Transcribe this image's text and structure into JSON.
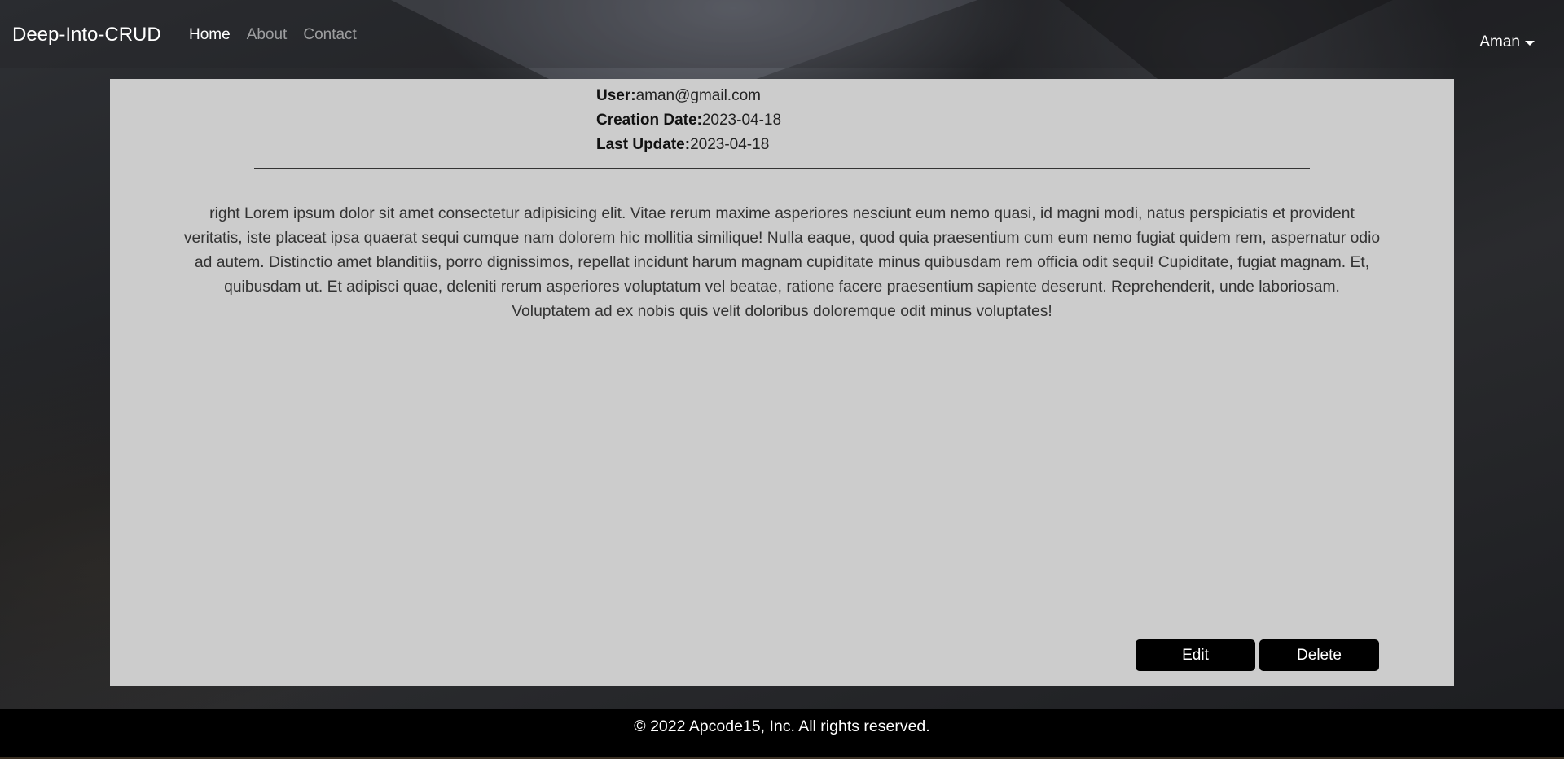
{
  "navbar": {
    "brand": "Deep-Into-CRUD",
    "links": [
      {
        "label": "Home",
        "active": true
      },
      {
        "label": "About",
        "active": false
      },
      {
        "label": "Contact",
        "active": false
      }
    ],
    "user": "Aman",
    "user_icon": "caret-down-icon"
  },
  "post": {
    "user_label": "User:",
    "user_value": "aman@gmail.com",
    "creation_label": "Creation Date:",
    "creation_value": "2023-04-18",
    "update_label": "Last Update:",
    "update_value": "2023-04-18",
    "body": "right Lorem ipsum dolor sit amet consectetur adipisicing elit. Vitae rerum maxime asperiores nesciunt eum nemo quasi, id magni modi, natus perspiciatis et provident veritatis, iste placeat ipsa quaerat sequi cumque nam dolorem hic mollitia similique! Nulla eaque, quod quia praesentium cum eum nemo fugiat quidem rem, aspernatur odio ad autem. Distinctio amet blanditiis, porro dignissimos, repellat incidunt harum magnam cupiditate minus quibusdam rem officia odit sequi! Cupiditate, fugiat magnam. Et, quibusdam ut. Et adipisci quae, deleniti rerum asperiores voluptatum vel beatae, ratione facere praesentium sapiente deserunt. Reprehenderit, unde laboriosam. Voluptatem ad ex nobis quis velit doloribus doloremque odit minus voluptates!",
    "edit_label": "Edit",
    "delete_label": "Delete"
  },
  "footer": {
    "text": "© 2022 Apcode15, Inc. All rights reserved."
  },
  "colors": {
    "card_bg": "#cccccc",
    "button_bg": "#000000",
    "footer_bg": "#000000"
  }
}
